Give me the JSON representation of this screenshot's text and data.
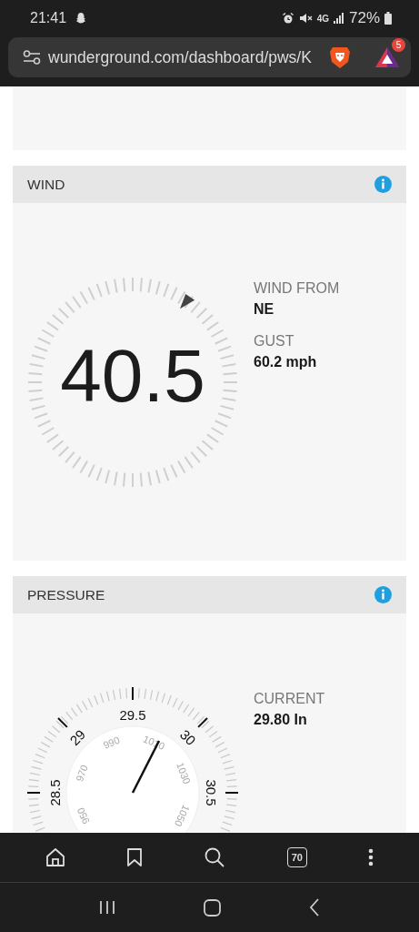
{
  "status_bar": {
    "time": "21:41",
    "network": "4G",
    "battery": "72%"
  },
  "address_bar": {
    "url": "wunderground.com/dashboard/pws/K",
    "notification_count": "5"
  },
  "wind": {
    "title": "WIND",
    "speed": "40.5",
    "details": [
      {
        "label": "WIND FROM",
        "value": "NE"
      },
      {
        "label": "GUST",
        "value": "60.2 mph"
      }
    ]
  },
  "pressure": {
    "title": "PRESSURE",
    "outer_scale": [
      "28.5",
      "29",
      "29.5",
      "30",
      "30.5"
    ],
    "inner_scale": [
      "950",
      "970",
      "990",
      "1010",
      "1030",
      "1050"
    ],
    "details": [
      {
        "label": "CURRENT",
        "value": "29.80 In"
      }
    ]
  },
  "toolbar": {
    "tab_count": "70"
  }
}
